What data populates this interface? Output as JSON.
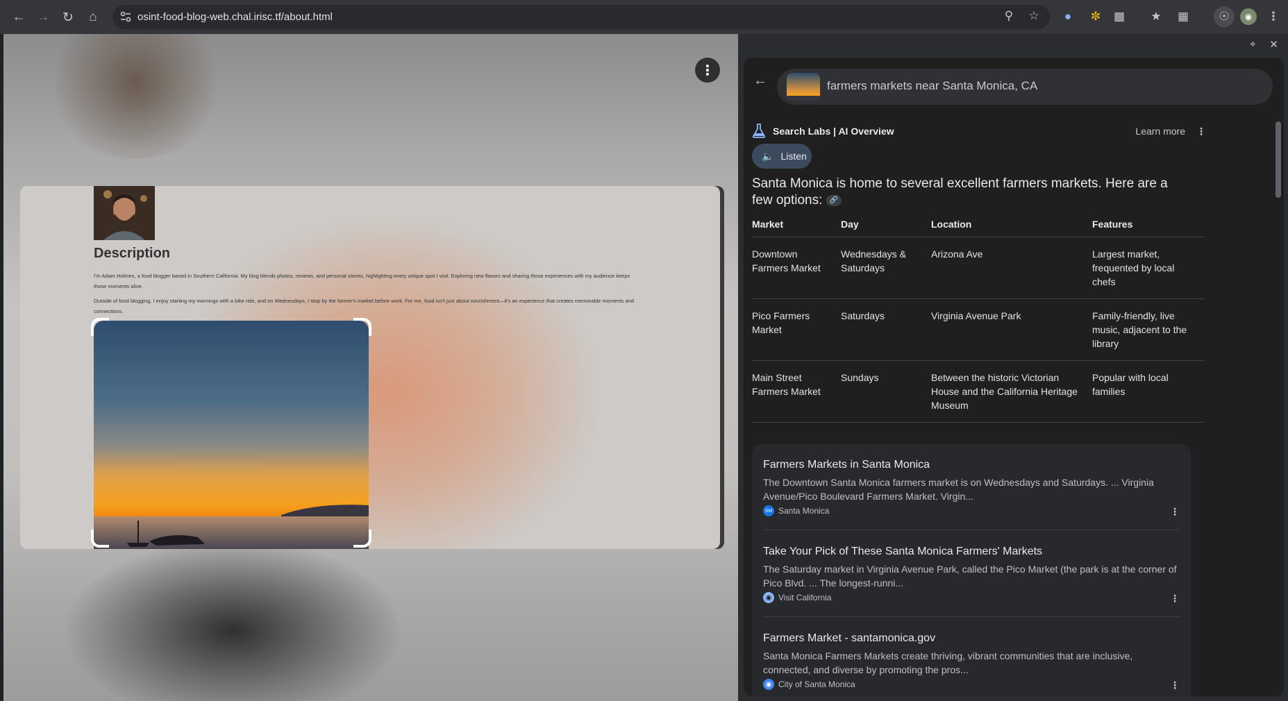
{
  "browser": {
    "url": "osint-food-blog-web.chal.irisc.tf/about.html"
  },
  "page": {
    "description_title": "Description",
    "paragraph1": "I'm Adam Holmes, a food blogger based in Southern California. My blog blends photos, reviews, and personal stories, highlighting every unique spot I visit. Exploring new flavors and sharing those experiences with my audience keeps those moments alive.",
    "paragraph2": "Outside of food blogging, I enjoy starting my mornings with a bike ride, and on Wednesdays, I stop by the farmer's market before work. For me, food isn't just about nourishment—it's an experience that creates memorable moments and connections."
  },
  "side_panel": {
    "search_query": "farmers markets near Santa Monica, CA",
    "labs_title": "Search Labs | AI Overview",
    "learn_more": "Learn more",
    "listen_label": "Listen",
    "summary": "Santa Monica is home to several excellent farmers markets. Here are a few options:",
    "table": {
      "headers": [
        "Market",
        "Day",
        "Location",
        "Features"
      ],
      "rows": [
        [
          "Downtown Farmers Market",
          "Wednesdays & Saturdays",
          "Arizona Ave",
          "Largest market, frequented by local chefs"
        ],
        [
          "Pico Farmers Market",
          "Saturdays",
          "Virginia Avenue Park",
          "Family-friendly, live music, adjacent to the library"
        ],
        [
          "Main Street Farmers Market",
          "Sundays",
          "Between the historic Victorian House and the California Heritage Museum",
          "Popular with local families"
        ]
      ]
    },
    "results": [
      {
        "title": "Farmers Markets in Santa Monica",
        "snippet": "The Downtown Santa Monica farmers market is on Wednesdays and Saturdays. ... Virginia Avenue/Pico Boulevard Farmers Market. Virgin...",
        "source": "Santa Monica",
        "favicon_text": "SM",
        "favicon_color": "#1a73e8"
      },
      {
        "title": "Take Your Pick of These Santa Monica Farmers' Markets",
        "snippet": "The Saturday market in Virginia Avenue Park, called the Pico Market (the park is at the corner of Pico Blvd. ... The longest-runni...",
        "source": "Visit California",
        "favicon_text": "",
        "favicon_color": "#8ab4f8"
      },
      {
        "title": "Farmers Market - santamonica.gov",
        "snippet": "Santa Monica Farmers Markets create thriving, vibrant communities that are inclusive, connected, and diverse by promoting the pros...",
        "source": "City of Santa Monica",
        "favicon_text": "",
        "favicon_color": "#4285f4"
      }
    ]
  }
}
